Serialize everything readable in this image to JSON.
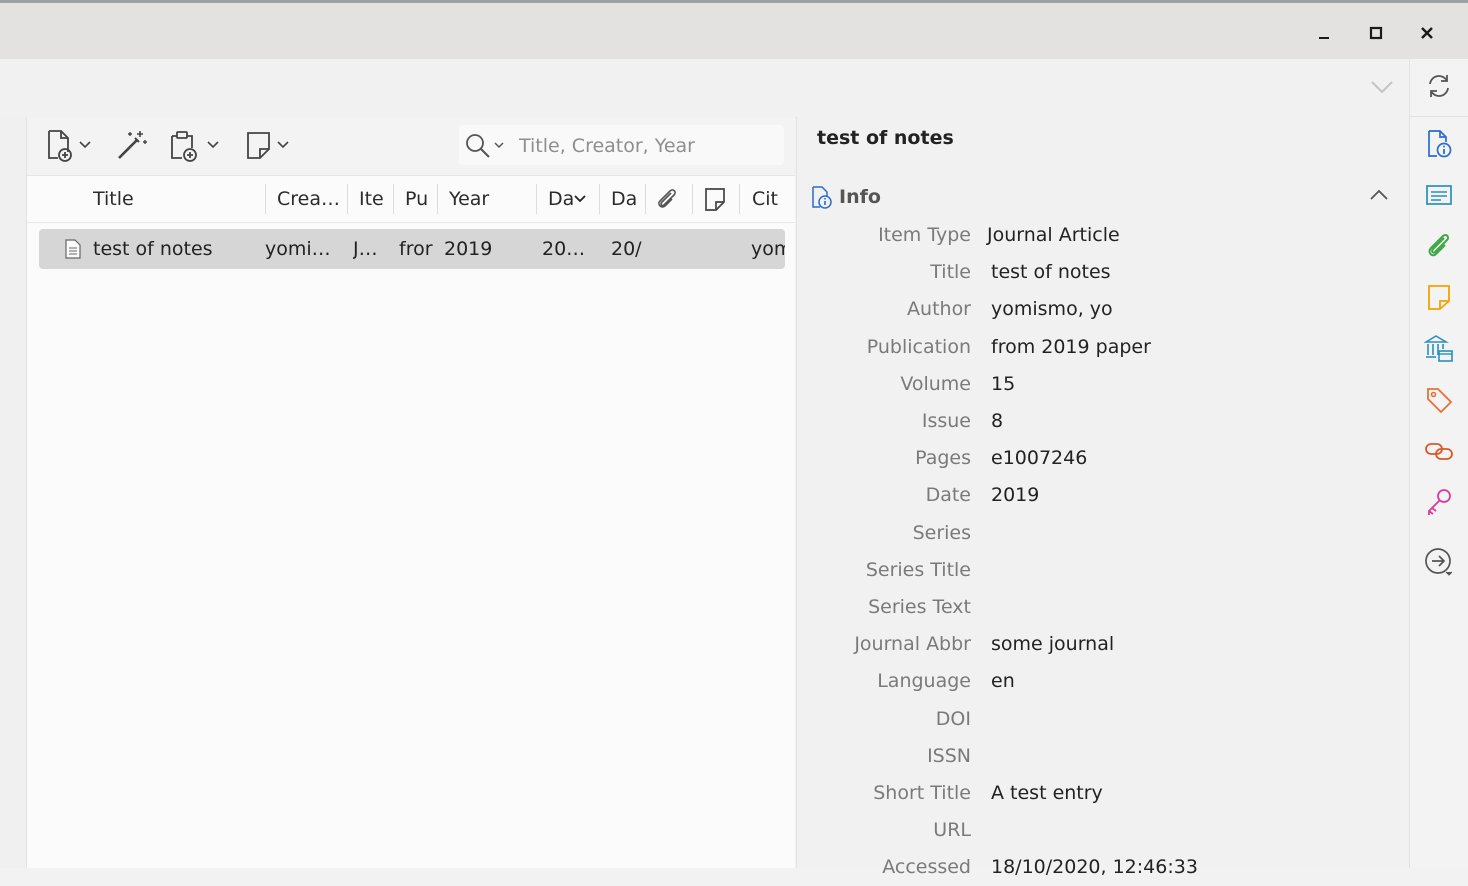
{
  "window": {
    "minimize_icon": "minimize-icon",
    "maximize_icon": "maximize-icon",
    "close_icon": "close-icon"
  },
  "toolbar": {
    "new_item_icon": "new-item-icon",
    "magic_wand_icon": "add-by-identifier-icon",
    "new_attachment_icon": "new-attachment-icon",
    "new_note_icon": "new-note-icon",
    "search_placeholder": "Title, Creator, Year",
    "search_value": ""
  },
  "columns": {
    "title": "Title",
    "creator": "Crea…",
    "item_type": "Ite",
    "publication": "Pu",
    "year": "Year",
    "date_added": "Da",
    "date_modified": "Da",
    "citation": "Cit"
  },
  "rows": [
    {
      "title": "test of notes",
      "creator": "yomi…",
      "item_type": "J…",
      "publication": "fror",
      "year": "2019",
      "date_added": "20…",
      "date_modified": "20/",
      "citation": "yom"
    }
  ],
  "detail": {
    "title": "test of notes",
    "section_title": "Info",
    "fields": [
      {
        "label": "Item Type",
        "value": "Journal Article"
      },
      {
        "label": "Title",
        "value": "test of notes"
      },
      {
        "label": "Author",
        "value": "yomismo, yo"
      },
      {
        "label": "Publication",
        "value": "from 2019 paper"
      },
      {
        "label": "Volume",
        "value": "15"
      },
      {
        "label": "Issue",
        "value": "8"
      },
      {
        "label": "Pages",
        "value": "e1007246"
      },
      {
        "label": "Date",
        "value": "2019"
      },
      {
        "label": "Series",
        "value": ""
      },
      {
        "label": "Series Title",
        "value": ""
      },
      {
        "label": "Series Text",
        "value": ""
      },
      {
        "label": "Journal Abbr",
        "value": "some journal"
      },
      {
        "label": "Language",
        "value": "en"
      },
      {
        "label": "DOI",
        "value": ""
      },
      {
        "label": "ISSN",
        "value": ""
      },
      {
        "label": "Short Title",
        "value": "A test entry"
      },
      {
        "label": "URL",
        "value": ""
      },
      {
        "label": "Accessed",
        "value": "18/10/2020, 12:46:33"
      }
    ]
  },
  "sidenav": {
    "sync_icon": "sync-icon",
    "info_icon": "info-icon",
    "abstract_icon": "abstract-icon",
    "attachments_icon": "attachments-icon",
    "notes_icon": "notes-icon",
    "libraries_icon": "libraries-collections-icon",
    "tags_icon": "tags-icon",
    "related_icon": "related-icon",
    "key_icon": "key-icon",
    "locate_icon": "locate-icon"
  },
  "colors": {
    "accent": "#2b6cd1",
    "selected_row": "#d6d6d6",
    "attachments": "#3fa845",
    "notes": "#f0a500",
    "tags": "#e8703a",
    "related": "#d85a28",
    "key": "#d93b9a",
    "libraries": "#2b8fbf"
  }
}
